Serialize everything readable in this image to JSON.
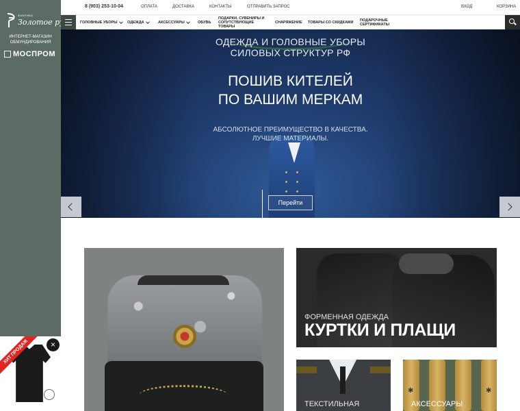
{
  "sidebar": {
    "logo_small": "ФАБРИКА",
    "logo_text": "Золотое руно",
    "tagline_line1": "ИНТЕРНЕТ-МАГАЗИН",
    "tagline_line2": "ОБМУНДИРОВАНИЯ",
    "partner": "МОСПРОМ"
  },
  "topbar": {
    "phone": "8 (903) 253-10-04",
    "links": [
      "ОПЛАТА",
      "ДОСТАВКА",
      "КОНТАКТЫ",
      "ОТПРАВИТЬ ЗАПРОС"
    ],
    "login": "ВХОД",
    "cart": "КОРЗИНА"
  },
  "nav": {
    "items": [
      {
        "label": "ГОЛОВНЫЕ УБОРЫ",
        "dropdown": true
      },
      {
        "label": "ОДЕЖДА",
        "dropdown": true
      },
      {
        "label": "АКСЕССУАРЫ",
        "dropdown": true
      },
      {
        "label": "ОБУВЬ",
        "dropdown": false
      },
      {
        "label": "ПОДАРКИ, СУВЕНИРЫ И СОПУТСТВУЮЩИЕ ТОВАРЫ",
        "dropdown": false
      },
      {
        "label": "СНАРЯЖЕНИЕ",
        "dropdown": false
      },
      {
        "label": "ТОВАРЫ СО СКИДКАМИ",
        "dropdown": false
      },
      {
        "label": "ПОДАРОЧНЫЕ СЕРТИФИКАТЫ",
        "dropdown": false
      }
    ],
    "menu_icon": "hamburger-icon",
    "search_icon": "search-icon"
  },
  "hero": {
    "subtitle_line1": "ОДЕЖДА И ГОЛОВНЫЕ УБОРЫ",
    "subtitle_line2": "СИЛОВЫХ СТРУКТУР РФ",
    "title_line1": "ПОШИВ КИТЕЛЕЙ",
    "title_line2": "ПО ВАШИМ МЕРКАМ",
    "desc_line1": "АБСОЛЮТНОЕ ПРЕИМУЩЕСТВО В КАЧЕСТВА.",
    "desc_line2": "ЛУЧШИЕ МАТЕРИАЛЫ.",
    "button": "Перейти",
    "prev_icon": "chevron-left-icon",
    "next_icon": "chevron-right-icon"
  },
  "tiles": {
    "jackets_small": "ФОРМЕННАЯ ОДЕЖДА",
    "jackets_big": "КУРТКИ И ПЛАЩИ",
    "textile": "ТЕКСТИЛЬНАЯ",
    "accessories": "АКСЕССУАРЫ"
  },
  "popup": {
    "ribbon": "ХИТ ПРОДАЖ",
    "close": "×"
  },
  "colors": {
    "sidebar": "#5c6b64",
    "hero_blue": "#1f3c6e",
    "ribbon_red": "#e0261f",
    "dark": "#2b2b2b"
  }
}
